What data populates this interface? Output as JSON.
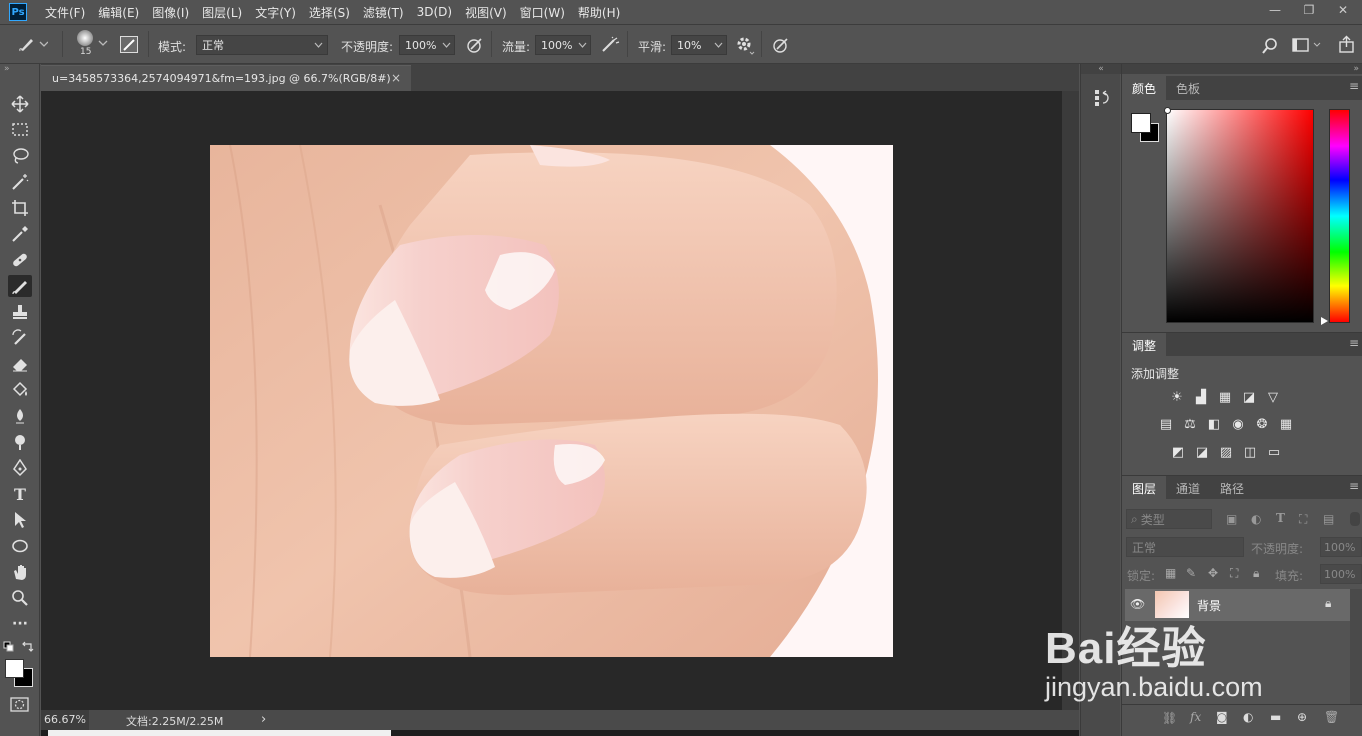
{
  "menubar": {
    "logo": "Ps",
    "items": [
      "文件(F)",
      "编辑(E)",
      "图像(I)",
      "图层(L)",
      "文字(Y)",
      "选择(S)",
      "滤镜(T)",
      "3D(D)",
      "视图(V)",
      "窗口(W)",
      "帮助(H)"
    ],
    "minimize": "—",
    "restore": "❐",
    "close": "✕"
  },
  "options": {
    "brush_size": "15",
    "mode_label": "模式:",
    "mode_value": "正常",
    "opacity_label": "不透明度:",
    "opacity_value": "100%",
    "flow_label": "流量:",
    "flow_value": "100%",
    "smooth_label": "平滑:",
    "smooth_value": "10%"
  },
  "document": {
    "tab_title": "u=3458573364,2574094971&fm=193.jpg @ 66.7%(RGB/8#)",
    "tab_close": "×"
  },
  "status": {
    "zoom": "66.67%",
    "doc_info": "文档:2.25M/2.25M",
    "arrow": "›"
  },
  "color_panel": {
    "tabs": [
      "颜色",
      "色板"
    ]
  },
  "adjust_panel": {
    "tab": "调整",
    "add_label": "添加调整"
  },
  "layers_panel": {
    "tabs": [
      "图层",
      "通道",
      "路径"
    ],
    "filter_label": "类型",
    "blend_mode": "正常",
    "opacity_label": "不透明度:",
    "opacity_value": "100%",
    "lock_label": "锁定:",
    "fill_label": "填充:",
    "fill_value": "100%",
    "layer_name": "背景"
  },
  "watermark": {
    "brand": "Bai经验",
    "url": "jingyan.baidu.com"
  },
  "colors": {
    "ui_bg": "#535353",
    "canvas_bg": "#282828",
    "accent": "#31a8ff"
  }
}
